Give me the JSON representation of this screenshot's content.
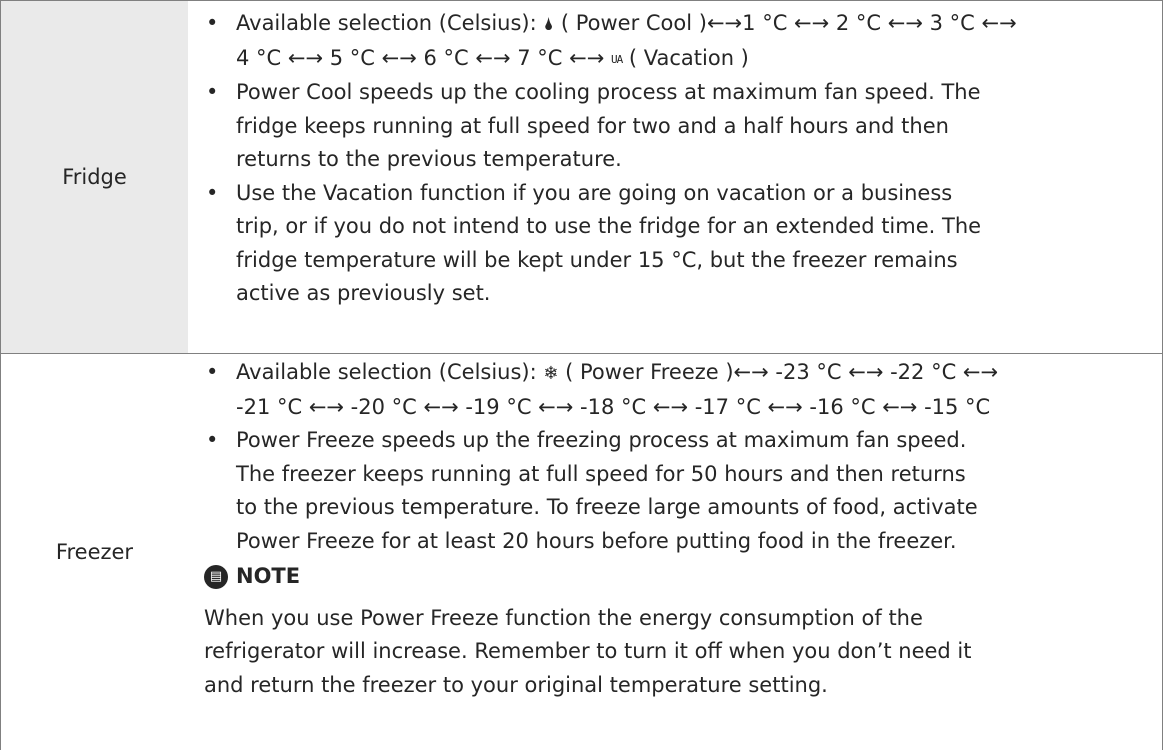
{
  "fridge": {
    "label": "Fridge",
    "bullets": [
      {
        "lines": [
          {
            "pre": "Available selection (Celsius): ",
            "icon": "power-cool-icon",
            "post": " ( Power Cool )←→1 °C ←→ 2 °C ←→ 3 °C ←→"
          },
          {
            "pre": "4 °C ←→ 5 °C ←→ 6 °C ←→ 7 °C ←→ ",
            "icon": "vacation-icon",
            "vac": "UA",
            "post": " ( Vacation )"
          }
        ]
      },
      {
        "lines": [
          "Power Cool speeds up the cooling process at maximum fan speed. The",
          "fridge keeps running at full speed for two and a half hours and then",
          "returns to the previous temperature."
        ]
      },
      {
        "lines": [
          "Use the Vacation function if you are going on vacation or a business",
          "trip, or if you do not intend to use the fridge for an extended time. The",
          "fridge temperature will be kept under 15 °C, but the freezer remains",
          "active as previously set."
        ]
      }
    ]
  },
  "freezer": {
    "label": "Freezer",
    "bullets": [
      {
        "lines": [
          {
            "pre": "Available selection (Celsius): ",
            "icon": "power-freeze-icon",
            "post": " ( Power Freeze )←→ -23 °C ←→ -22 °C ←→"
          },
          "-21 °C ←→ -20 °C ←→ -19 °C ←→ -18 °C ←→ -17 °C ←→ -16 °C ←→ -15 °C"
        ]
      },
      {
        "lines": [
          "Power Freeze speeds up the freezing process at maximum fan speed.",
          "The freezer keeps running at full speed for 50 hours and then returns",
          "to the previous temperature. To freeze large amounts of food, activate",
          "Power Freeze for at least 20 hours before putting food in the freezer."
        ]
      }
    ],
    "note": {
      "title": "NOTE",
      "lines": [
        "When you use Power Freeze function the energy consumption of the",
        "refrigerator will increase. Remember to turn it off when you don’t need it",
        "and return the freezer to your original temperature setting."
      ]
    }
  }
}
